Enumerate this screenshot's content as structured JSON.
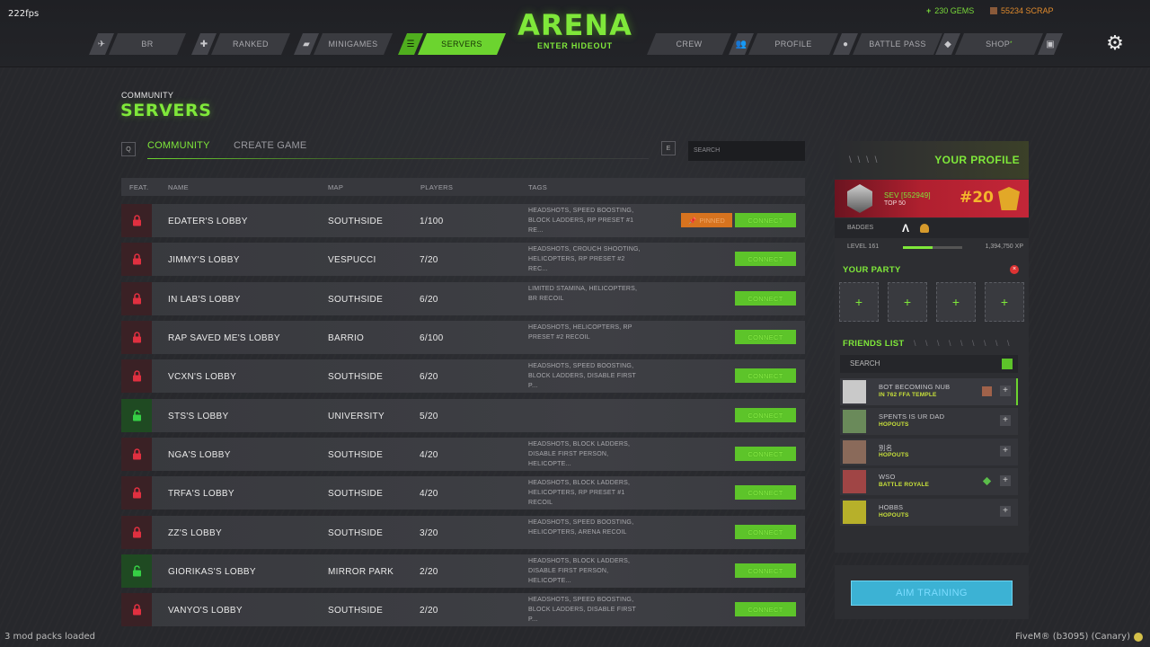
{
  "overlay": {
    "fps": "222fps",
    "status_bottom": "3 mod packs loaded",
    "fivem": "FiveM® (b3095) (Canary)"
  },
  "header": {
    "logo_title": "ARENA",
    "logo_sub": "ENTER HIDEOUT",
    "nav_left": [
      {
        "label": "BR",
        "icon": "plane-icon"
      },
      {
        "label": "RANKED",
        "icon": "crosshair-icon"
      },
      {
        "label": "MINIGAMES",
        "icon": "gamepad-icon"
      },
      {
        "label": "SERVERS",
        "icon": "server-icon",
        "active": true
      }
    ],
    "nav_right": [
      {
        "label": "CREW",
        "icon": "group-icon"
      },
      {
        "label": "PROFILE",
        "icon": "user-icon"
      },
      {
        "label": "BATTLE PASS",
        "icon": "ticket-icon"
      },
      {
        "label": "SHOP",
        "badge": "*",
        "icon": "store-icon"
      }
    ],
    "gems": "230 GEMS",
    "scrap": "55234 SCRAP",
    "settings_icon": "gear-icon"
  },
  "page": {
    "kicker": "COMMUNITY",
    "title": "SERVERS"
  },
  "tabs": {
    "left_key": "Q",
    "right_key": "E",
    "community": "COMMUNITY",
    "create": "CREATE GAME",
    "search_placeholder": "SEARCH"
  },
  "table": {
    "headers": {
      "feat": "FEAT.",
      "name": "NAME",
      "map": "MAP",
      "players": "PLAYERS",
      "tags": "TAGS"
    },
    "connect_label": "CONNECT",
    "pinned_label": "PINNED",
    "rows": [
      {
        "name": "EDATER'S LOBBY",
        "map": "SOUTHSIDE",
        "players": "1/100",
        "tags": "HEADSHOTS, SPEED BOOSTING, BLOCK LADDERS, RP PRESET #1 RE...",
        "locked": true,
        "pinned": true
      },
      {
        "name": "JIMMY'S LOBBY",
        "map": "VESPUCCI",
        "players": "7/20",
        "tags": "HEADSHOTS, CROUCH SHOOTING, HELICOPTERS, RP PRESET #2 REC...",
        "locked": true
      },
      {
        "name": "IN LAB'S LOBBY",
        "map": "SOUTHSIDE",
        "players": "6/20",
        "tags": "LIMITED STAMINA, HELICOPTERS, BR RECOIL",
        "locked": true
      },
      {
        "name": "RAP SAVED ME'S LOBBY",
        "map": "BARRIO",
        "players": "6/100",
        "tags": "HEADSHOTS, HELICOPTERS, RP PRESET #2 RECOIL",
        "locked": true
      },
      {
        "name": "VCXN'S LOBBY",
        "map": "SOUTHSIDE",
        "players": "6/20",
        "tags": "HEADSHOTS, SPEED BOOSTING, BLOCK LADDERS, DISABLE FIRST P...",
        "locked": true
      },
      {
        "name": "STS'S LOBBY",
        "map": "UNIVERSITY",
        "players": "5/20",
        "tags": "",
        "locked": false
      },
      {
        "name": "NGA'S LOBBY",
        "map": "SOUTHSIDE",
        "players": "4/20",
        "tags": "HEADSHOTS, BLOCK LADDERS, DISABLE FIRST PERSON, HELICOPTE...",
        "locked": true
      },
      {
        "name": "TRFA'S LOBBY",
        "map": "SOUTHSIDE",
        "players": "4/20",
        "tags": "HEADSHOTS, BLOCK LADDERS, HELICOPTERS, RP PRESET #1 RECOIL",
        "locked": true
      },
      {
        "name": "ZZ'S LOBBY",
        "map": "SOUTHSIDE",
        "players": "3/20",
        "tags": "HEADSHOTS, SPEED BOOSTING, HELICOPTERS, ARENA RECOIL",
        "locked": true
      },
      {
        "name": "GIORIKAS'S LOBBY",
        "map": "MIRROR PARK",
        "players": "2/20",
        "tags": "HEADSHOTS, BLOCK LADDERS, DISABLE FIRST PERSON, HELICOPTE...",
        "locked": false
      },
      {
        "name": "VANYO'S LOBBY",
        "map": "SOUTHSIDE",
        "players": "2/20",
        "tags": "HEADSHOTS, SPEED BOOSTING, BLOCK LADDERS, DISABLE FIRST P...",
        "locked": true
      }
    ]
  },
  "profile": {
    "dashes": "\\ \\ \\ \\",
    "title": "YOUR PROFILE",
    "name": "SEV [552949]",
    "top": "TOP 50",
    "rank": "#20",
    "badges_label": "BADGES",
    "level": "LEVEL 161",
    "level_progress": 0.5,
    "xp": "1,394,750 XP",
    "party_title": "YOUR PARTY",
    "party_close": "×",
    "party_slot": "+",
    "friends_title": "FRIENDS LIST",
    "friends_dashes": "\\ \\ \\ \\ \\ \\ \\ \\ \\",
    "friends_search": "SEARCH",
    "friends": [
      {
        "name": "BOT BECOMING NUB",
        "status": "IN 762 FFA TEMPLE",
        "avatar_color": "#c9c9c9",
        "extra": "crate-icon"
      },
      {
        "name": "SPENTS IS UR DAD",
        "status": "HOPOUTS",
        "avatar_color": "#6a8a5a"
      },
      {
        "name": "別名",
        "status": "HOPOUTS",
        "avatar_color": "#8a6a5a"
      },
      {
        "name": "WSO",
        "status": "BATTLE ROYALE",
        "avatar_color": "#a04545",
        "extra": "diamond-icon"
      },
      {
        "name": "HOBBS",
        "status": "HOPOUTS",
        "avatar_color": "#b7b02a"
      }
    ],
    "plus": "+",
    "aim_training": "AIM TRAINING"
  }
}
